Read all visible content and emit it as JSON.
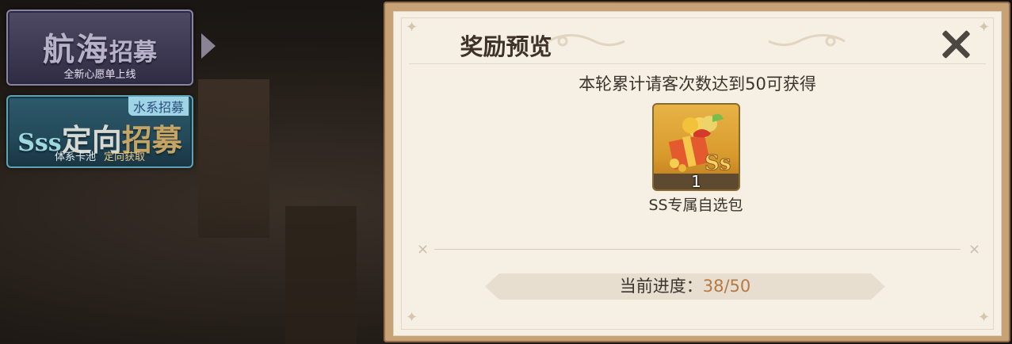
{
  "left_panel": {
    "nav_recruit": {
      "title_big": "航海",
      "title_small": "招募",
      "subtitle": "全新心愿单上线"
    },
    "directed_recruit": {
      "tag": "水系招募",
      "title_prefix": "Sss",
      "title_main": "定向",
      "title_suffix": "招募",
      "subtitle_left": "体系卡池",
      "subtitle_right": "定向获取"
    }
  },
  "dialog": {
    "title": "奖励预览",
    "condition": "本轮累计请客次数达到50可获得",
    "reward": {
      "icon": "gift-box-icon",
      "count": "1",
      "name": "SS专属自选包"
    },
    "progress": {
      "label": "当前进度：",
      "value": "38/50"
    }
  },
  "colors": {
    "dialog_bg": "#f5efe4",
    "frame": "#c8a277",
    "progress_value": "#b47a45",
    "nav_button": "#3c3852",
    "directed_button": "#23495a"
  }
}
